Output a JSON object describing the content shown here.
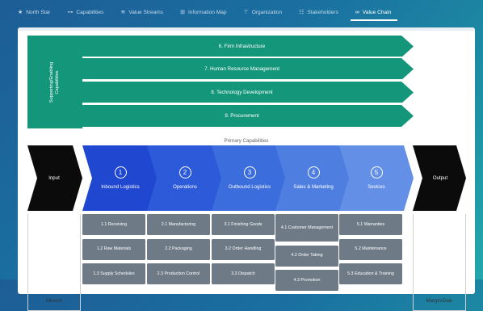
{
  "nav": {
    "items": [
      {
        "label": "North Star",
        "icon": "star-icon"
      },
      {
        "label": "Capabilities",
        "icon": "hierarchy-icon"
      },
      {
        "label": "Value Streams",
        "icon": "streams-icon"
      },
      {
        "label": "Information Map",
        "icon": "map-icon"
      },
      {
        "label": "Organization",
        "icon": "org-icon"
      },
      {
        "label": "Stakeholders",
        "icon": "stakeholders-icon"
      },
      {
        "label": "Value Chain",
        "icon": "link-icon"
      }
    ],
    "active": "Value Chain"
  },
  "support": {
    "title": "Supporting/Enabling\nCapabilities",
    "rows": [
      "6. Firm Infrastructure",
      "7. Human Resource Management",
      "8. Technology Development",
      "9. Procurement"
    ]
  },
  "primary": {
    "title": "Primary Capabilities",
    "input_label": "Input",
    "output_label": "Output",
    "mission_label": "Mission",
    "margin_label": "Margin/Gain",
    "stages": [
      {
        "num": "1",
        "name": "Inbound Logistics",
        "color": "#1f47d0",
        "caps": [
          "1.1 Receiving",
          "1.2 Raw Materials",
          "1.3 Supply Schedules"
        ]
      },
      {
        "num": "2",
        "name": "Operations",
        "color": "#2c5ad8",
        "caps": [
          "2.1 Manufacturing",
          "2.2 Packaging",
          "2.3 Production Control"
        ]
      },
      {
        "num": "3",
        "name": "Outbound Logistics",
        "color": "#3c6ddc",
        "caps": [
          "3.1 Finishing Goods",
          "3.2 Order Handling",
          "3.3 Dispatch"
        ]
      },
      {
        "num": "4",
        "name": "Sales & Marketing",
        "color": "#4e7fe0",
        "caps": [
          "4.1 Customer Management",
          "4.2 Order Taking",
          "4.3 Promotion"
        ]
      },
      {
        "num": "5",
        "name": "Sevices",
        "color": "#6390e6",
        "caps": [
          "5.1 Warranties",
          "5.2 Maintenance",
          "5.3 Education & Training"
        ]
      }
    ]
  },
  "colors": {
    "support_green": "#14967a",
    "input_output_black": "#0b0b0b",
    "capability_gray": "#6e7b87"
  }
}
